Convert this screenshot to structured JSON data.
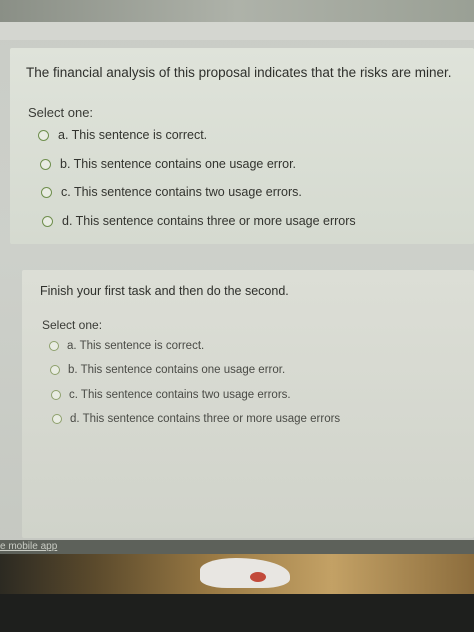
{
  "question1": {
    "text": "The financial analysis of this proposal indicates that the risks are miner.",
    "select_label": "Select one:",
    "options": [
      "a. This sentence is correct.",
      "b. This sentence contains one usage error.",
      "c. This sentence contains two usage errors.",
      "d. This sentence contains three or more usage errors"
    ]
  },
  "question2": {
    "text": "Finish your first task and then do the second.",
    "select_label": "Select one:",
    "options": [
      "a. This sentence is correct.",
      "b. This sentence contains one usage error.",
      "c. This sentence contains two usage errors.",
      "d. This sentence contains three or more usage errors"
    ]
  },
  "footer": {
    "mobile_link": "e mobile app"
  },
  "colors": {
    "radio_border": "#6f8f4e",
    "card_bg": "#d9ddd4"
  }
}
